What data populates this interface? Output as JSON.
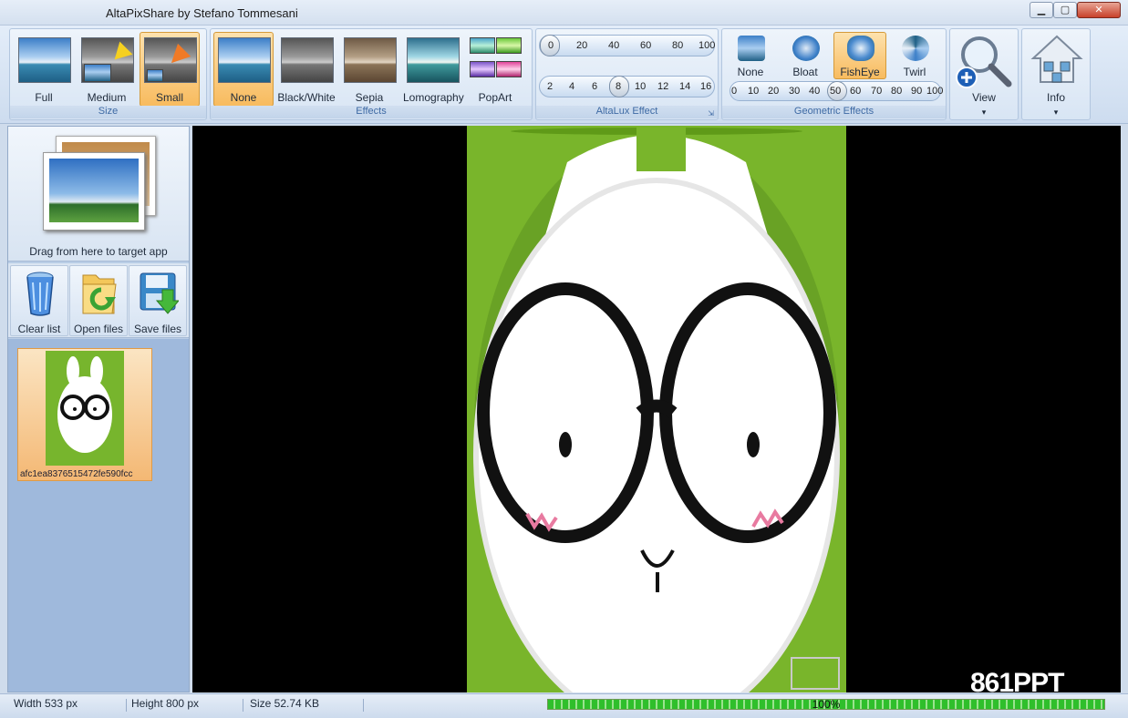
{
  "window": {
    "title": "AltaPixShare by Stefano Tommesani",
    "min_glyph": "▁",
    "max_glyph": "▢",
    "close_glyph": "✕"
  },
  "ribbon": {
    "size_group": {
      "label": "Size",
      "buttons": [
        {
          "label": "Full"
        },
        {
          "label": "Medium"
        },
        {
          "label": "Small",
          "active": true
        }
      ]
    },
    "effects_group": {
      "label": "Effects",
      "buttons": [
        {
          "label": "None",
          "active": true
        },
        {
          "label": "Black/White"
        },
        {
          "label": "Sepia"
        },
        {
          "label": "Lomography"
        },
        {
          "label": "PopArt"
        }
      ]
    },
    "altalux_group": {
      "label": "AltaLux Effect",
      "slider1_ticks": [
        "0",
        "20",
        "40",
        "60",
        "80",
        "100"
      ],
      "slider1_value": 0,
      "slider2_ticks": [
        "2",
        "4",
        "6",
        "8",
        "10",
        "12",
        "14",
        "16"
      ],
      "slider2_value": 8
    },
    "geometric_group": {
      "label": "Geometric Effects",
      "buttons": [
        {
          "label": "None"
        },
        {
          "label": "Bloat"
        },
        {
          "label": "FishEye",
          "active": true
        },
        {
          "label": "Twirl"
        }
      ],
      "slider_ticks": [
        "0",
        "10",
        "20",
        "30",
        "40",
        "50",
        "60",
        "70",
        "80",
        "90",
        "100"
      ],
      "slider_value": 50
    },
    "view_button": {
      "label": "View",
      "dropdown": "▾"
    },
    "info_button": {
      "label": "Info",
      "dropdown": "▾"
    }
  },
  "sidebar": {
    "drag_text": "Drag from here to target app",
    "actions": [
      {
        "label": "Clear list"
      },
      {
        "label": "Open files"
      },
      {
        "label": "Save files"
      }
    ],
    "files": [
      {
        "name": "afc1ea8376515472fe590fcc"
      }
    ]
  },
  "status": {
    "width": "Width 533 px",
    "height": "Height 800 px",
    "size": "Size 52.74 KB",
    "progress_text": "100%",
    "progress_value": 1.0
  },
  "watermark": "861PPT",
  "colors": {
    "accent_active": "#f8bb5f",
    "ribbon_bg": "#d8e5f4",
    "image_bg": "#79b52b"
  }
}
